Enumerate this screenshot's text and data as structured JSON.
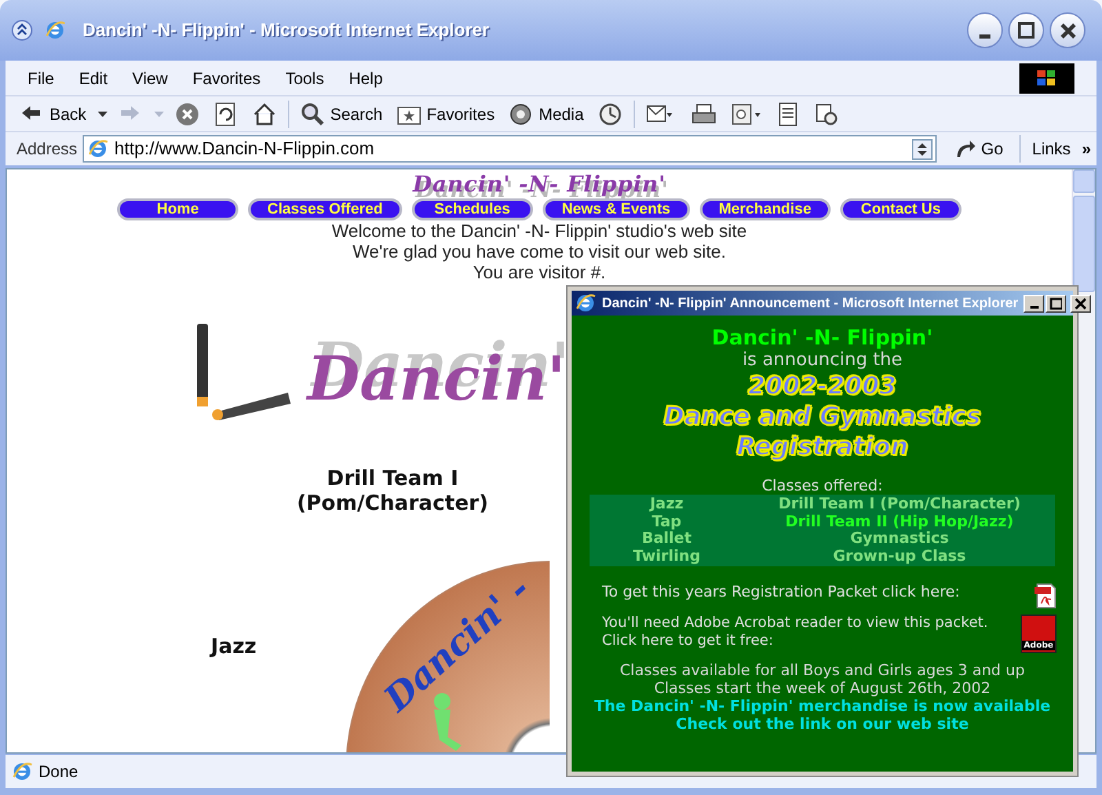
{
  "window": {
    "title": "Dancin' -N- Flippin' - Microsoft Internet Explorer"
  },
  "menu": [
    "File",
    "Edit",
    "View",
    "Favorites",
    "Tools",
    "Help"
  ],
  "toolbar": [
    {
      "kind": "back",
      "label": "Back"
    },
    {
      "kind": "forward"
    },
    {
      "kind": "stop"
    },
    {
      "kind": "refresh"
    },
    {
      "kind": "home"
    },
    {
      "kind": "search",
      "label": "Search"
    },
    {
      "kind": "favorites",
      "label": "Favorites"
    },
    {
      "kind": "media",
      "label": "Media"
    },
    {
      "kind": "history"
    },
    {
      "kind": "mail"
    },
    {
      "kind": "print"
    },
    {
      "kind": "edit"
    },
    {
      "kind": "discuss"
    },
    {
      "kind": "research"
    }
  ],
  "address": {
    "label": "Address",
    "value": "http://www.Dancin-N-Flippin.com",
    "go": "Go",
    "links": "Links",
    "more": "»"
  },
  "page": {
    "site_title": "Dancin' -N- Flippin'",
    "nav": [
      "Home",
      "Classes Offered",
      "Schedules",
      "News & Events",
      "Merchandise",
      "Contact Us"
    ],
    "welcome": [
      "Welcome to the Dancin' -N- Flippin' studio's web site",
      "We're glad you have come to visit our web site.",
      "You are visitor #."
    ],
    "logo_text": "Dancin'",
    "disc_text": "Dancin' -",
    "class_titles": [
      {
        "lines": [
          "Drill Team I",
          "(Pom/Character)"
        ]
      },
      {
        "lines": [
          "Jazz"
        ]
      }
    ]
  },
  "popup": {
    "title": "Dancin' -N- Flippin' Announcement - Microsoft Internet Explorer",
    "name": "Dancin' -N- Flippin'",
    "announcing": "is announcing the",
    "headline": [
      "2002-2003",
      "Dance and Gymnastics",
      "Registration"
    ],
    "classes_heading": "Classes offered:",
    "classes": [
      {
        "left": "Jazz",
        "right": "Drill Team I (Pom/Character)",
        "highlighted": false
      },
      {
        "left": "Tap",
        "right": "Drill Team II (Hip Hop/Jazz)",
        "highlighted": true
      },
      {
        "left": "Ballet",
        "right": "Gymnastics",
        "highlighted": false
      },
      {
        "left": "Twirling",
        "right": "Grown-up Class",
        "highlighted": false
      }
    ],
    "packet_text": "To get this years Registration Packet click here:",
    "acrobat_lines": [
      "You'll need Adobe Acrobat reader to view this packet.",
      "Click here to get it free:"
    ],
    "adobe_label": "Adobe",
    "info_lines": [
      "Classes available for all Boys and Girls ages 3 and up",
      "Classes start the week of August 26th, 2002"
    ],
    "promo_lines": [
      "The Dancin' -N- Flippin' merchandise is now available",
      "Check out the link on our web site"
    ]
  },
  "status": {
    "text": "Done"
  }
}
